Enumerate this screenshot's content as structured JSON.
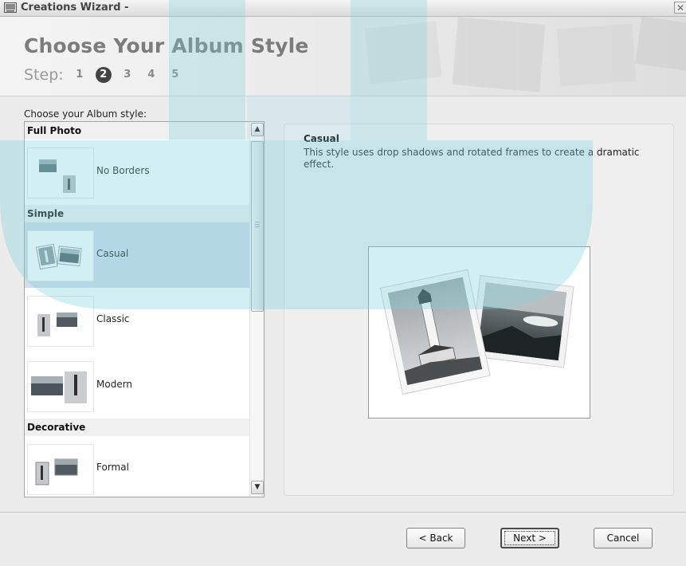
{
  "window": {
    "title": "Creations Wizard -",
    "close_glyph": "✕"
  },
  "header": {
    "title": "Choose Your Album Style",
    "steps_label": "Step:",
    "steps": [
      "1",
      "2",
      "3",
      "4",
      "5"
    ],
    "current_step": "2"
  },
  "style_list": {
    "caption": "Choose your Album style:",
    "groups": [
      {
        "name": "Full Photo",
        "items": [
          {
            "label": "No Borders",
            "selected": false
          }
        ]
      },
      {
        "name": "Simple",
        "items": [
          {
            "label": "Casual",
            "selected": true
          },
          {
            "label": "Classic",
            "selected": false
          },
          {
            "label": "Modern",
            "selected": false
          }
        ]
      },
      {
        "name": "Decorative",
        "items": [
          {
            "label": "Formal",
            "selected": false
          }
        ]
      }
    ],
    "scroll_up_glyph": "▲",
    "scroll_down_glyph": "▼"
  },
  "preview": {
    "name": "Casual",
    "description": "This style uses drop shadows and rotated frames to create a dramatic effect."
  },
  "buttons": {
    "back": "< Back",
    "next": "Next >",
    "cancel": "Cancel"
  },
  "colors": {
    "selected_row": "#d2dcec",
    "watermark": "#7fd0de",
    "header_title": "#7c7c7c"
  }
}
